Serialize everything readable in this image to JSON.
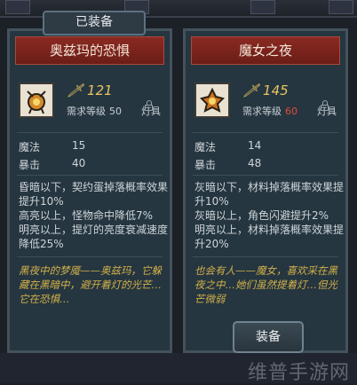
{
  "equipped_tab": "已装备",
  "cards": [
    {
      "name": "奥兹玛的恐惧",
      "power": "121",
      "req_label": "需求等级",
      "req_level": "50",
      "slot": "灯具",
      "stats": [
        {
          "label": "魔法",
          "value": "15"
        },
        {
          "label": "暴击",
          "value": "40"
        }
      ],
      "effects": [
        "昏暗以下，契约蛋掉落概率效果",
        "提升10%",
        "高亮以上，怪物命中降低7%",
        "明亮以上，提灯的亮度衰减速度",
        "降低25%"
      ],
      "lore": [
        "黑夜中的梦魇——奥兹玛，它躲",
        "藏在黑暗中，避开着灯的光芒…",
        "它在恐惧…"
      ]
    },
    {
      "name": "魔女之夜",
      "power": "145",
      "req_label": "需求等级",
      "req_level": "60",
      "slot": "灯具",
      "stats": [
        {
          "label": "魔法",
          "value": "14"
        },
        {
          "label": "暴击",
          "value": "48"
        }
      ],
      "effects": [
        "灰暗以下，材料掉落概率效果提",
        "升10%",
        "灰暗以上，角色闪避提升2%",
        "明亮以上，材料掉落概率效果提",
        "升20%"
      ],
      "lore": [
        "也会有人——魔女，喜欢采在黑",
        "夜之中…她们虽然提着灯…但光",
        "芒微弱"
      ]
    }
  ],
  "equip_button": "装备",
  "watermark": "维普手游网",
  "colors": {
    "header_red": "#8a2a22",
    "power_gold": "#e6c560",
    "lore_gold": "#d3b04a",
    "req_red": "#e04a3b"
  },
  "icons": {
    "power": "sword-power-icon",
    "slot_lock": "lock-icon",
    "item_left": "lantern-ozma-icon",
    "item_right": "lantern-witch-icon"
  }
}
